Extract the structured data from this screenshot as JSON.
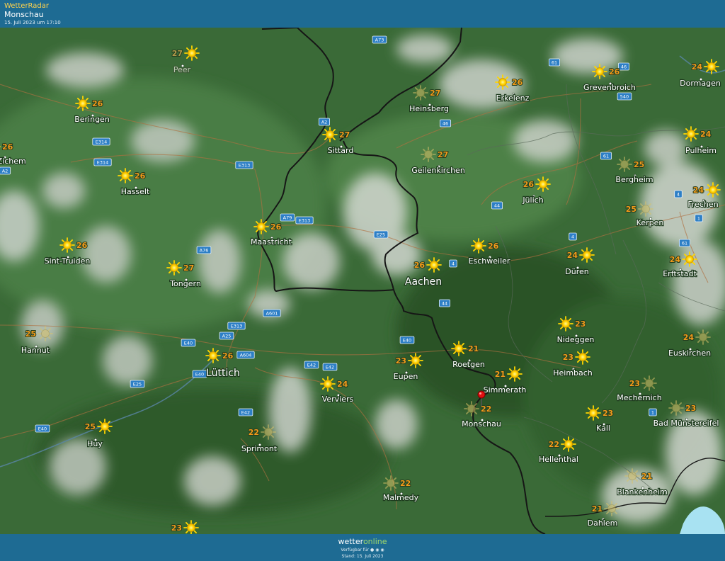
{
  "header": {
    "brand": "WetterRadar",
    "location": "Monschau",
    "timestamp": "15. Juli 2023 um 17:10"
  },
  "footer": {
    "logo_a": "wetter",
    "logo_b": "online",
    "available": "Verfügbar für ● ◉ ◉",
    "stand": "Stand: 15. Juli 2023"
  },
  "colors": {
    "bar": "#1e6b93",
    "brand": "#ffd34d",
    "temperature": "#f29a1a",
    "sun": "#ffd600",
    "pin": "#e01010"
  },
  "cities": [
    {
      "name": "Peer",
      "temp": "27"
    },
    {
      "name": "Beringen",
      "temp": "26"
    },
    {
      "name": "vel-Zichem",
      "temp": "26"
    },
    {
      "name": "Hasselt",
      "temp": "26"
    },
    {
      "name": "Sint-Truiden",
      "temp": "26"
    },
    {
      "name": "Tongern",
      "temp": "27"
    },
    {
      "name": "Hannut",
      "temp": "25"
    },
    {
      "name": "Huy",
      "temp": "25"
    },
    {
      "name": "Lüttich",
      "temp": "26"
    },
    {
      "name": "Sprimont",
      "temp": "22"
    },
    {
      "name": "Maastricht",
      "temp": "26"
    },
    {
      "name": "Sittard",
      "temp": "27"
    },
    {
      "name": "Heinsberg",
      "temp": "27"
    },
    {
      "name": "Erkelenz",
      "temp": "26"
    },
    {
      "name": "Grevenbroich",
      "temp": "26"
    },
    {
      "name": "Dormagen",
      "temp": "24"
    },
    {
      "name": "Geilenkirchen",
      "temp": "27"
    },
    {
      "name": "Pulheim",
      "temp": "24"
    },
    {
      "name": "Bergheim",
      "temp": "25"
    },
    {
      "name": "Jülich",
      "temp": "26"
    },
    {
      "name": "Frechen",
      "temp": "24"
    },
    {
      "name": "Kerpen",
      "temp": "25"
    },
    {
      "name": "Eschweiler",
      "temp": "26"
    },
    {
      "name": "Düren",
      "temp": "24"
    },
    {
      "name": "Aachen",
      "temp": "26"
    },
    {
      "name": "Erftstadt",
      "temp": "24"
    },
    {
      "name": "Nideggen",
      "temp": "23"
    },
    {
      "name": "Euskirchen",
      "temp": "24"
    },
    {
      "name": "Roetgen",
      "temp": "21"
    },
    {
      "name": "Heimbach",
      "temp": "23"
    },
    {
      "name": "Eupen",
      "temp": "23"
    },
    {
      "name": "Verviers",
      "temp": "24"
    },
    {
      "name": "Simmerath",
      "temp": "21"
    },
    {
      "name": "Mechernich",
      "temp": "23"
    },
    {
      "name": "Monschau",
      "temp": "22"
    },
    {
      "name": "Kall",
      "temp": "23"
    },
    {
      "name": "Bad Münstereifel",
      "temp": "23"
    },
    {
      "name": "Hellenthal",
      "temp": "22"
    },
    {
      "name": "Blankenheim",
      "temp": "21"
    },
    {
      "name": "Malmedy",
      "temp": "22"
    },
    {
      "name": "Dahlem",
      "temp": "21"
    },
    {
      "name": "",
      "temp": "23"
    }
  ],
  "roads": [
    "A73",
    "A2",
    "E314",
    "E314",
    "E313",
    "A2",
    "A79",
    "E313",
    "A76",
    "E25",
    "A601",
    "E313",
    "E40",
    "A25",
    "A604",
    "E40",
    "E42",
    "E42",
    "E25",
    "E42",
    "E40",
    "E40",
    "61",
    "46",
    "46",
    "540",
    "61",
    "4",
    "44",
    "4",
    "1",
    "61",
    "4",
    "44",
    "1"
  ]
}
